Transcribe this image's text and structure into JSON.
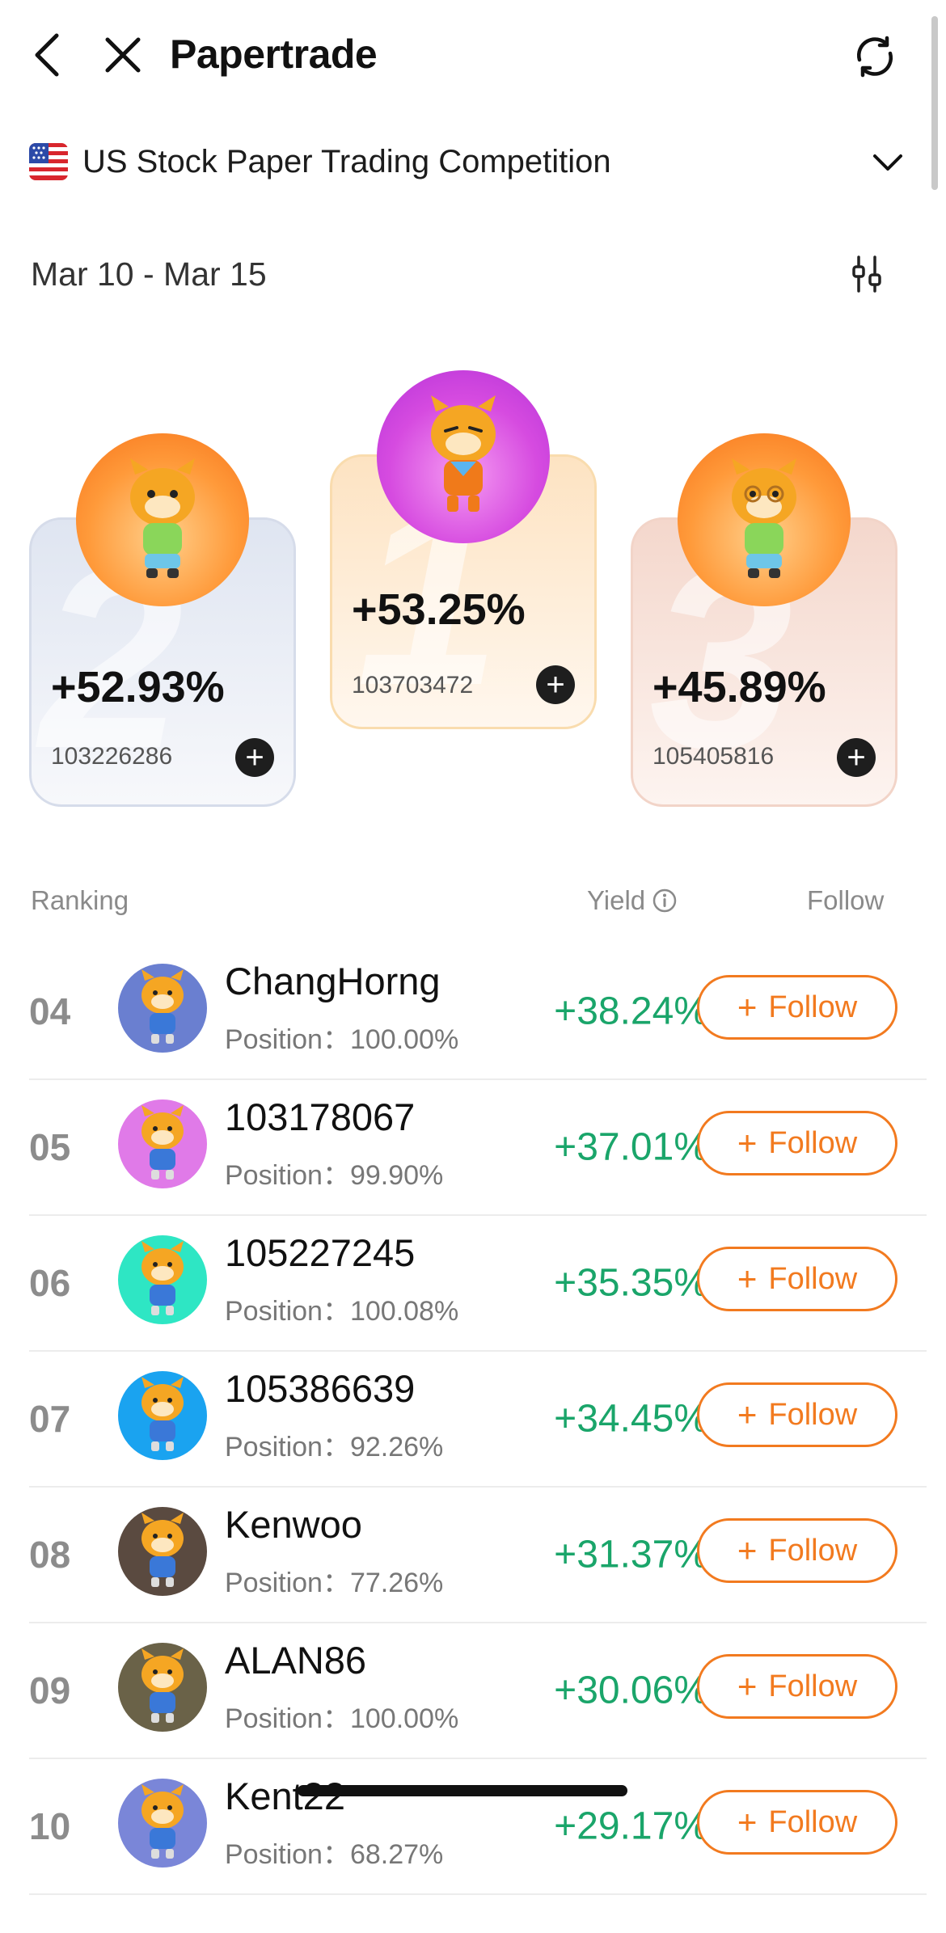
{
  "header": {
    "title": "Papertrade",
    "back_icon": "chevron-left-icon",
    "close_icon": "close-icon",
    "refresh_icon": "refresh-icon"
  },
  "competition": {
    "flag": "us-flag-icon",
    "name": "US Stock Paper Trading Competition",
    "dropdown_icon": "chevron-down-icon"
  },
  "period": {
    "date_range": "Mar 10 - Mar 15",
    "filter_icon": "sliders-icon"
  },
  "podium": [
    {
      "rank": "1",
      "yield": "+53.25%",
      "user_id": "103703472",
      "avatar_color": "#d64be0"
    },
    {
      "rank": "2",
      "yield": "+52.93%",
      "user_id": "103226286",
      "avatar_color": "#ff9a3a"
    },
    {
      "rank": "3",
      "yield": "+45.89%",
      "user_id": "105405816",
      "avatar_color": "#ff9a3a"
    }
  ],
  "list_header": {
    "ranking": "Ranking",
    "yield": "Yield",
    "follow": "Follow"
  },
  "rows": [
    {
      "rank": "04",
      "name": "ChangHorng",
      "position_label": "Position：",
      "position": "100.00%",
      "yield": "+38.24%",
      "follow_label": "Follow",
      "avatar_bg": "#6a7fd0"
    },
    {
      "rank": "05",
      "name": "103178067",
      "position_label": "Position：",
      "position": "99.90%",
      "yield": "+37.01%",
      "follow_label": "Follow",
      "avatar_bg": "#e07ae8"
    },
    {
      "rank": "06",
      "name": "105227245",
      "position_label": "Position：",
      "position": "100.08%",
      "yield": "+35.35%",
      "follow_label": "Follow",
      "avatar_bg": "#2ee6c4"
    },
    {
      "rank": "07",
      "name": "105386639",
      "position_label": "Position：",
      "position": "92.26%",
      "yield": "+34.45%",
      "follow_label": "Follow",
      "avatar_bg": "#1aa3f0"
    },
    {
      "rank": "08",
      "name": "Kenwoo",
      "position_label": "Position：",
      "position": "77.26%",
      "yield": "+31.37%",
      "follow_label": "Follow",
      "avatar_bg": "#5a4a40"
    },
    {
      "rank": "09",
      "name": "ALAN86",
      "position_label": "Position：",
      "position": "100.00%",
      "yield": "+30.06%",
      "follow_label": "Follow",
      "avatar_bg": "#6a6248"
    },
    {
      "rank": "10",
      "name": "Kent22",
      "position_label": "Position：",
      "position": "68.27%",
      "yield": "+29.17%",
      "follow_label": "Follow",
      "avatar_bg": "#7a86d8"
    }
  ],
  "colors": {
    "accent": "#f27a1f",
    "positive": "#1aa56a",
    "text": "#111111"
  }
}
